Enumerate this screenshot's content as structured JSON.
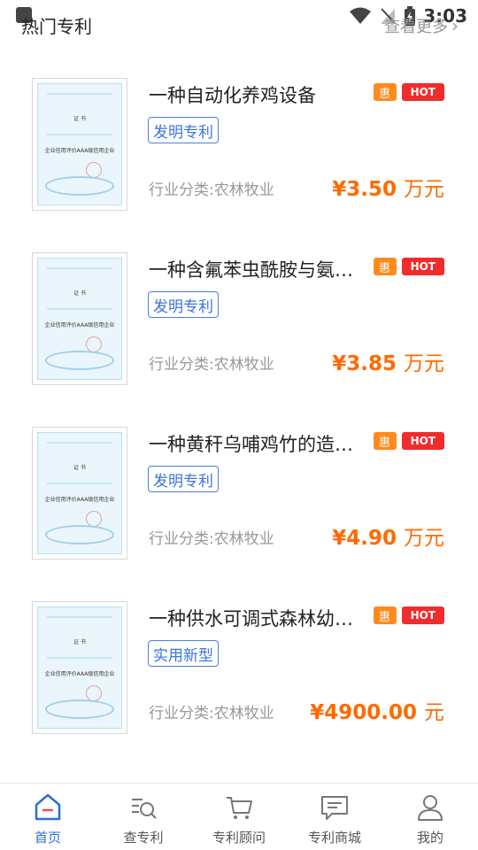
{
  "status_bar": {
    "time": "3:03"
  },
  "header": {
    "title": "热门专利",
    "more_label": "查看更多"
  },
  "items": [
    {
      "name": "一种自动化养鸡设备",
      "badge_discount": "惠",
      "badge_hot": "HOT",
      "type": "发明专利",
      "industry": "行业分类:农林牧业",
      "price": "¥3.50",
      "price_unit": "万元"
    },
    {
      "name": "一种含氟苯虫酰胺与氨基…",
      "badge_discount": "惠",
      "badge_hot": "HOT",
      "type": "发明专利",
      "industry": "行业分类:农林牧业",
      "price": "¥3.85",
      "price_unit": "万元"
    },
    {
      "name": "一种黄秆乌哺鸡竹的造林…",
      "badge_discount": "惠",
      "badge_hot": "HOT",
      "type": "发明专利",
      "industry": "行业分类:农林牧业",
      "price": "¥4.90",
      "price_unit": "万元"
    },
    {
      "name": "一种供水可调式森林幼苗…",
      "badge_discount": "惠",
      "badge_hot": "HOT",
      "type": "实用新型",
      "industry": "行业分类:农林牧业",
      "price": "¥4900.00",
      "price_unit": "元"
    }
  ],
  "certificate": {
    "title": "证 书",
    "text": "企业信用评价AAA级信用企业"
  },
  "tabs": [
    {
      "label": "首页",
      "icon": "home-icon",
      "active": true
    },
    {
      "label": "查专利",
      "icon": "search-list-icon",
      "active": false
    },
    {
      "label": "专利顾问",
      "icon": "cart-icon",
      "active": false
    },
    {
      "label": "专利商城",
      "icon": "chat-icon",
      "active": false
    },
    {
      "label": "我的",
      "icon": "user-icon",
      "active": false
    }
  ],
  "colors": {
    "accent": "#2b6de0",
    "price": "#ff6a00",
    "hot": "#f12c2c",
    "discount": "#ff8a1d"
  }
}
